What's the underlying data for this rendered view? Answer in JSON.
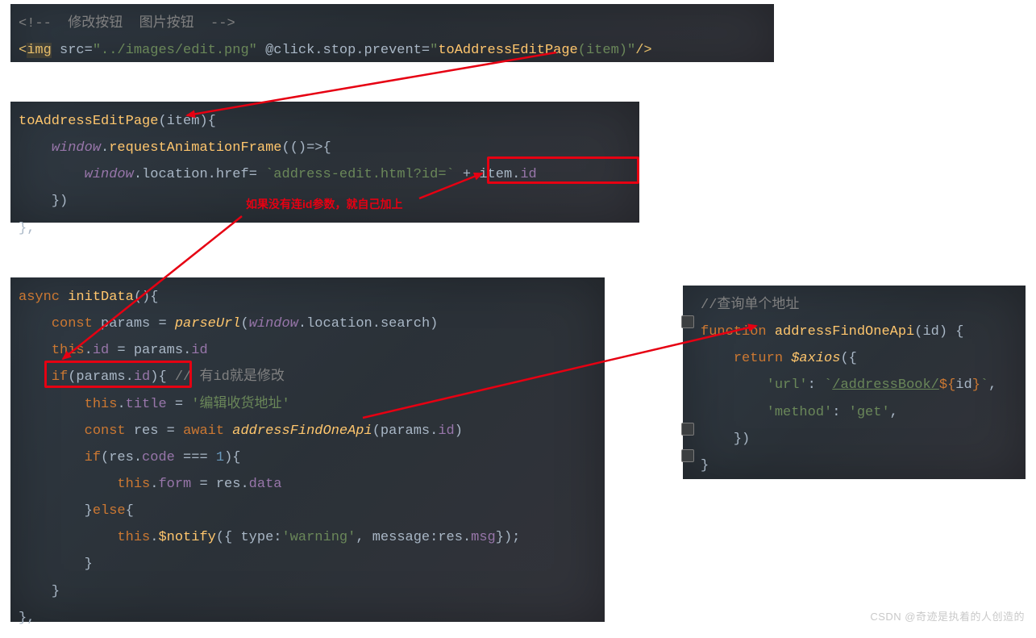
{
  "annotation": {
    "red_text": "如果没有连id参数，就自己加上"
  },
  "watermark": "CSDN @奇迹是执着的人创造的",
  "panel1": {
    "tokens": {
      "lt": "<",
      "gt": ">",
      "bang": "!--",
      "dashdash": "--",
      "comment_text": "  修改按钮  图片按钮  ",
      "img": "img",
      "space": " ",
      "src": "src",
      "eq": "=",
      "srcval": "\"../images/edit.png\"",
      "click": "@click.stop.prevent",
      "clickval_open": "\"",
      "fn": "toAddressEditPage",
      "paren_open": "(",
      "item": "item",
      "paren_close": ")",
      "clickval_close": "\"",
      "slash": "/"
    }
  },
  "panel2": {
    "tokens": {
      "fn": "toAddressEditPage",
      "po": "(",
      "item": "item",
      "pc": ")",
      "ob": "{",
      "window": "window",
      "dot": ".",
      "raf": "requestAnimationFrame",
      "arrow": "()=>",
      "loc": "location",
      "href": "href",
      "eq": "= ",
      "tpl": "`address-edit.html?id=`",
      "plus": " + ",
      "id": "id",
      "cb": "}",
      "cbr": "})",
      "comma": ","
    }
  },
  "panel3": {
    "tokens": {
      "async": "async",
      "init": "initData",
      "po": "()",
      "ob": "{",
      "const": "const",
      "params": "params",
      "eq": " = ",
      "parseUrl": "parseUrl",
      "window": "window",
      "dot": ".",
      "location": "location",
      "search": "search",
      "pc": ")",
      "this": "this",
      "id": "id",
      "paramsid": "params.id",
      "if": "if",
      "po2": "(",
      "pc2": ")",
      "ob2": "{",
      "cmt": "// 有id就是修改",
      "title": "title",
      "titlestr": "'编辑收货地址'",
      "res": "res",
      "await": "await",
      "afo": "addressFindOneApi",
      "code": "code",
      "teq": " === ",
      "one": "1",
      "form": "form",
      "data": "data",
      "else": "else",
      "notify": "$notify",
      "type": "type",
      "warning": "'warning'",
      "message": "message",
      "msg": "msg",
      "cb": "}",
      "comma": ",",
      "semi": ";"
    }
  },
  "panel4": {
    "tokens": {
      "cmt": "//查询单个地址",
      "function": "function",
      "afo": "addressFindOneApi",
      "po": "(",
      "id": "id",
      "pc": ")",
      "sp": " ",
      "ob": "{",
      "return": "return",
      "axios": "$axios",
      "url": "'url'",
      "colon": ": ",
      "bt": "`",
      "path": "/addressBook/",
      "dollar": "${",
      "cb": "}",
      "bt2": "`",
      "comma": ",",
      "method": "'method'",
      "get": "'get'",
      "cbr": "})"
    }
  }
}
